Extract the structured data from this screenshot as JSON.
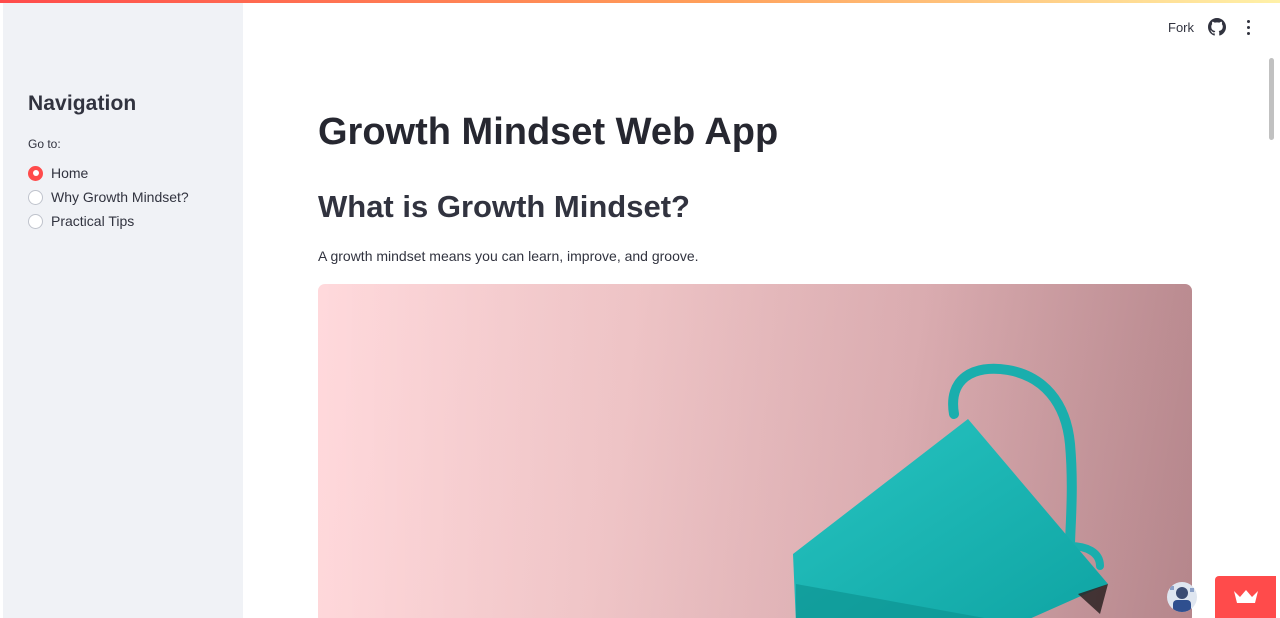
{
  "sidebar": {
    "title": "Navigation",
    "goto_label": "Go to:",
    "options": [
      {
        "label": "Home",
        "selected": true
      },
      {
        "label": "Why Growth Mindset?",
        "selected": false
      },
      {
        "label": "Practical Tips",
        "selected": false
      }
    ]
  },
  "toolbar": {
    "fork_label": "Fork",
    "github_icon": "github-icon",
    "menu_icon": "kebab-menu-icon"
  },
  "main": {
    "title": "Growth Mindset Web App",
    "section_heading": "What is Growth Mindset?",
    "body_text": "A growth mindset means you can learn, improve, and groove."
  },
  "colors": {
    "accent": "#ff4b4b",
    "sidebar_bg": "#f0f2f6",
    "text": "#31333f",
    "image_bg": "#fcd0d2",
    "bag": "#19b3b1"
  },
  "footer": {
    "avatar_icon": "user-avatar",
    "badge_icon": "crown-icon"
  }
}
